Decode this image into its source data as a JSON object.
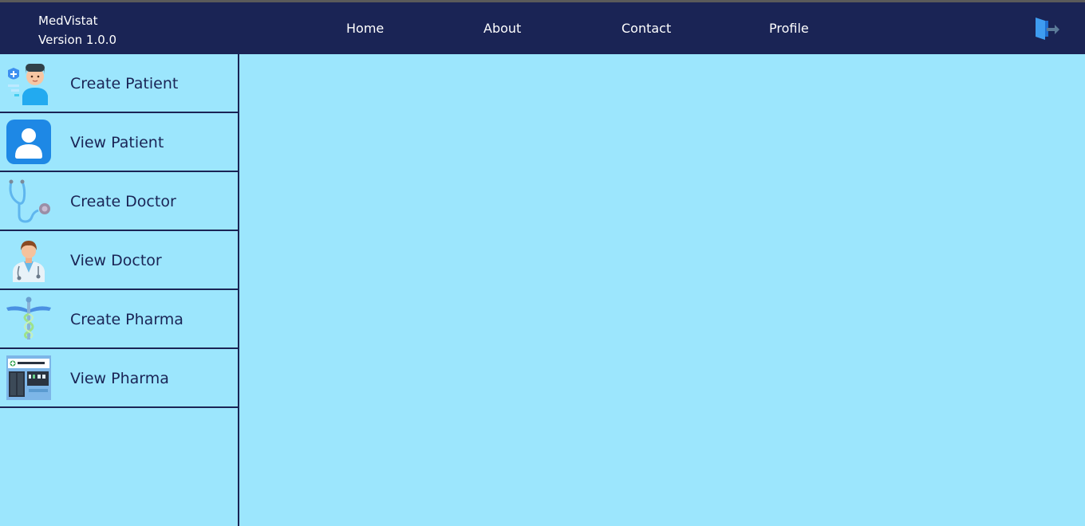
{
  "app": {
    "name": "MedVistat",
    "version": "Version 1.0.0"
  },
  "nav": {
    "links": [
      "Home",
      "About",
      "Contact",
      "Profile"
    ],
    "logout_icon": "logout-icon"
  },
  "sidebar": {
    "items": [
      {
        "label": "Create Patient",
        "icon": "patient-avatar-icon"
      },
      {
        "label": "View Patient",
        "icon": "user-profile-icon"
      },
      {
        "label": "Create Doctor",
        "icon": "stethoscope-icon"
      },
      {
        "label": "View Doctor",
        "icon": "doctor-icon"
      },
      {
        "label": "Create Pharma",
        "icon": "caduceus-icon"
      },
      {
        "label": "View Pharma",
        "icon": "pharmacy-store-icon"
      }
    ]
  },
  "colors": {
    "navbar": "#1a2455",
    "background": "#9ce6fd",
    "text_dark": "#1a2455",
    "nav_text": "#ffffff"
  }
}
